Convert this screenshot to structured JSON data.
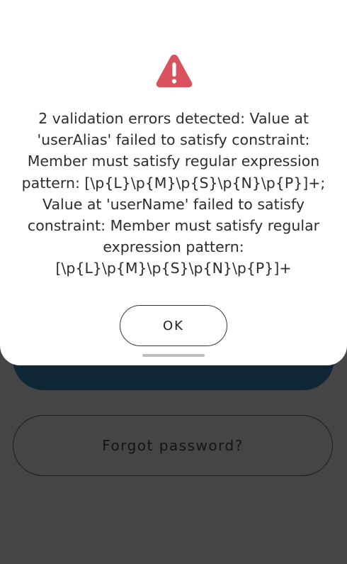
{
  "background": {
    "forgot_password_label": "Forgot password?"
  },
  "dialog": {
    "icon": "warning-triangle-icon",
    "icon_color": "#d9525e",
    "message": "2 validation errors detected: Value at 'userAlias' failed to satisfy constraint: Member must satisfy regular expression pattern: [\\p{L}\\p{M}\\p{S}\\p{N}\\p{P}]+; Value at 'userName' failed to satisfy constraint: Member must satisfy regular expression pattern: [\\p{L}\\p{M}\\p{S}\\p{N}\\p{P}]+",
    "ok_label": "OK"
  }
}
